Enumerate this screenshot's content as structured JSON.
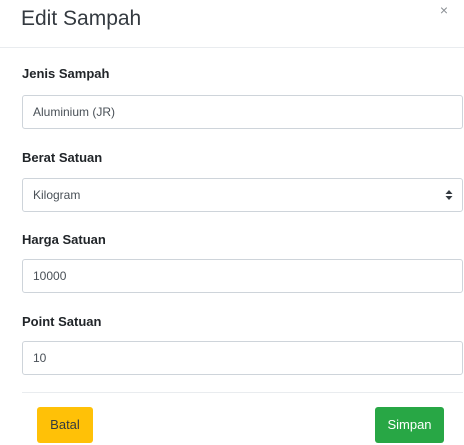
{
  "modal": {
    "title": "Edit Sampah",
    "close_glyph": "×"
  },
  "form": {
    "jenis_sampah": {
      "label": "Jenis Sampah",
      "value": "Aluminium (JR)"
    },
    "berat_satuan": {
      "label": "Berat Satuan",
      "selected": "Kilogram"
    },
    "harga_satuan": {
      "label": "Harga Satuan",
      "value": "10000"
    },
    "point_satuan": {
      "label": "Point Satuan",
      "value": "10"
    }
  },
  "footer": {
    "cancel_label": "Batal",
    "save_label": "Simpan"
  },
  "colors": {
    "cancel_button": "#ffc107",
    "save_button": "#28a745"
  },
  "icons": {
    "close": "close-icon",
    "select": "select-arrows-icon"
  }
}
